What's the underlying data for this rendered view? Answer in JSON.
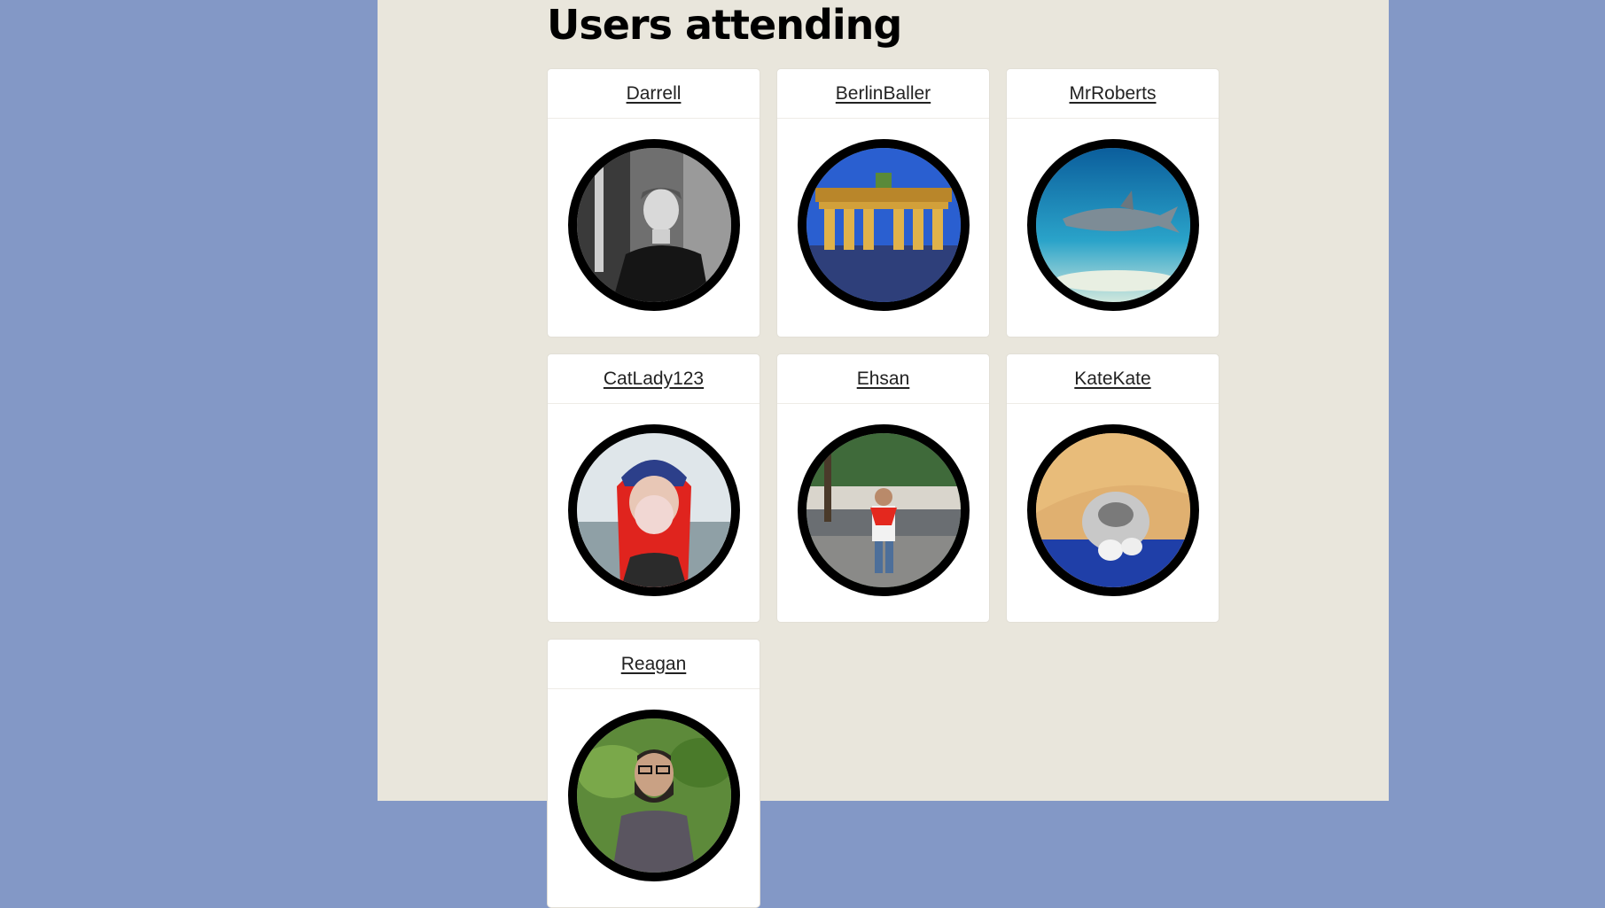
{
  "heading": "Users attending",
  "users": [
    {
      "name": "Darrell",
      "avatar": "portrait-photo-bw"
    },
    {
      "name": "BerlinBaller",
      "avatar": "brandenburg-gate-photo"
    },
    {
      "name": "MrRoberts",
      "avatar": "shark-photo"
    },
    {
      "name": "CatLady123",
      "avatar": "bubblegum-woman-photo"
    },
    {
      "name": "Ehsan",
      "avatar": "man-by-river-photo"
    },
    {
      "name": "KateKate",
      "avatar": "cat-under-blanket-photo"
    },
    {
      "name": "Reagan",
      "avatar": "bearded-man-photo"
    }
  ]
}
